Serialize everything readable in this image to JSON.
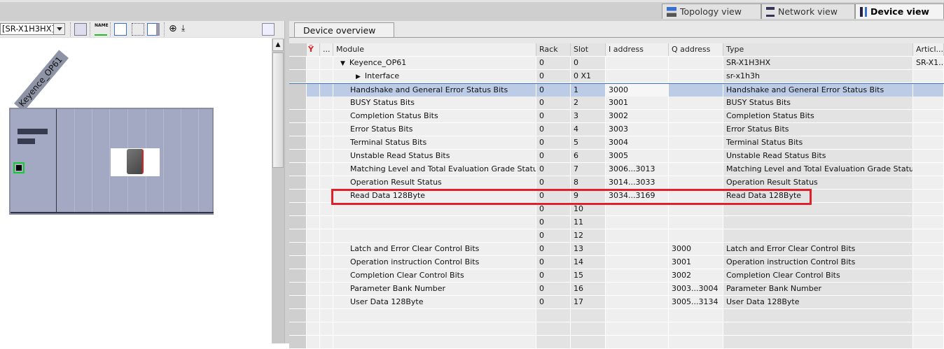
{
  "view_tabs": [
    {
      "label": "Topology view"
    },
    {
      "label": "Network view"
    },
    {
      "label": "Device view",
      "active": true
    }
  ],
  "left": {
    "device_select": "[SR-X1H3HX]",
    "device_label": "Keyence_OP61",
    "toolbar_icons": [
      "rack-width-icon",
      "name-icon",
      "show-hide-icon",
      "grid-icon",
      "table-icon",
      "zoom-icon",
      "download-icon",
      "user-settings-icon"
    ]
  },
  "overview": {
    "tab": "Device overview",
    "headers": {
      "diag": "",
      "dots": "...",
      "module": "Module",
      "rack": "Rack",
      "slot": "Slot",
      "i": "I address",
      "q": "Q address",
      "type": "Type",
      "article": "Articl..."
    },
    "rows": [
      {
        "module": "Keyence_OP61",
        "rack": "0",
        "slot": "0",
        "i": "",
        "q": "",
        "type": "SR-X1H3HX",
        "article": "SR-X1...",
        "expand": "down"
      },
      {
        "module": "Interface",
        "rack": "0",
        "slot": "0 X1",
        "i": "",
        "q": "",
        "type": "sr-x1h3h",
        "article": "",
        "expand": "right"
      },
      {
        "module": "Handshake and General Error Status Bits",
        "rack": "0",
        "slot": "1",
        "i": "3000",
        "q": "",
        "type": "Handshake and General Error Status Bits",
        "article": "",
        "selected": true
      },
      {
        "module": "BUSY Status Bits",
        "rack": "0",
        "slot": "2",
        "i": "3001",
        "q": "",
        "type": "BUSY Status Bits",
        "article": ""
      },
      {
        "module": "Completion Status Bits",
        "rack": "0",
        "slot": "3",
        "i": "3002",
        "q": "",
        "type": "Completion Status Bits",
        "article": ""
      },
      {
        "module": "Error Status Bits",
        "rack": "0",
        "slot": "4",
        "i": "3003",
        "q": "",
        "type": "Error Status Bits",
        "article": ""
      },
      {
        "module": "Terminal Status Bits",
        "rack": "0",
        "slot": "5",
        "i": "3004",
        "q": "",
        "type": "Terminal Status Bits",
        "article": ""
      },
      {
        "module": "Unstable Read Status Bits",
        "rack": "0",
        "slot": "6",
        "i": "3005",
        "q": "",
        "type": "Unstable Read Status Bits",
        "article": ""
      },
      {
        "module": "Matching Level and Total Evaluation Grade Status",
        "rack": "0",
        "slot": "7",
        "i": "3006...3013",
        "q": "",
        "type": "Matching Level and Total Evaluation Grade Status",
        "article": ""
      },
      {
        "module": "Operation Result Status",
        "rack": "0",
        "slot": "8",
        "i": "3014...3033",
        "q": "",
        "type": "Operation Result Status",
        "article": ""
      },
      {
        "module": "Read Data 128Byte",
        "rack": "0",
        "slot": "9",
        "i": "3034...3169",
        "q": "",
        "type": "Read Data 128Byte",
        "article": "",
        "highlighted": true
      },
      {
        "module": "",
        "rack": "0",
        "slot": "10",
        "i": "",
        "q": "",
        "type": "",
        "article": ""
      },
      {
        "module": "",
        "rack": "0",
        "slot": "11",
        "i": "",
        "q": "",
        "type": "",
        "article": ""
      },
      {
        "module": "",
        "rack": "0",
        "slot": "12",
        "i": "",
        "q": "",
        "type": "",
        "article": ""
      },
      {
        "module": "Latch and Error Clear Control Bits",
        "rack": "0",
        "slot": "13",
        "i": "",
        "q": "3000",
        "type": "Latch and Error Clear Control Bits",
        "article": ""
      },
      {
        "module": "Operation instruction Control Bits",
        "rack": "0",
        "slot": "14",
        "i": "",
        "q": "3001",
        "type": "Operation instruction Control Bits",
        "article": ""
      },
      {
        "module": "Completion Clear Control Bits",
        "rack": "0",
        "slot": "15",
        "i": "",
        "q": "3002",
        "type": "Completion Clear Control Bits",
        "article": ""
      },
      {
        "module": "Parameter Bank Number",
        "rack": "0",
        "slot": "16",
        "i": "",
        "q": "3003...3004",
        "type": "Parameter Bank Number",
        "article": ""
      },
      {
        "module": "User Data 128Byte",
        "rack": "0",
        "slot": "17",
        "i": "",
        "q": "3005...3134",
        "type": "User Data 128Byte",
        "article": ""
      }
    ]
  },
  "colors": {
    "highlight": "#e3202a",
    "selection": "#bccbe6",
    "rack": "#a3a9c2"
  }
}
